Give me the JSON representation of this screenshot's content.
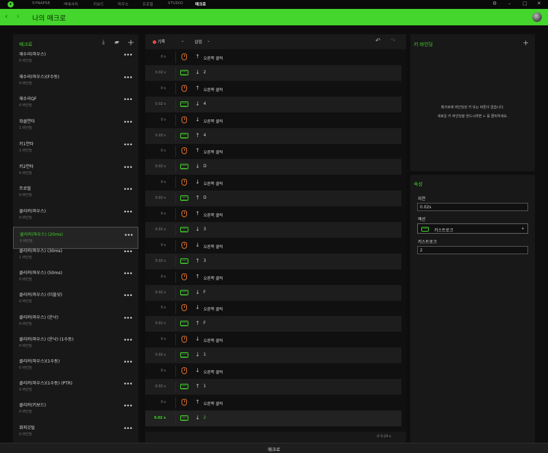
{
  "app": {
    "nav_tabs": [
      "SYNAPSE",
      "액세서리",
      "키보드",
      "마우스",
      "프로필",
      "STUDIO",
      "매크로"
    ],
    "active_tab": "매크로",
    "page_title": "나의 매크로",
    "accent_color": "#44d62c",
    "bottom_label": "매크로"
  },
  "macros": {
    "header": "매크로",
    "icons": [
      "import-icon",
      "folder-icon",
      "add-icon"
    ],
    "items": [
      {
        "name": "재수리(마우스)",
        "bind": "0 바인딩"
      },
      {
        "name": "재수리(마우스)(F수동)",
        "bind": "0 바인딩"
      },
      {
        "name": "재수리QF",
        "bind": "0 바인딩"
      },
      {
        "name": "좌클연타",
        "bind": "1 바인딩"
      },
      {
        "name": "키1연타",
        "bind": "1 바인딩"
      },
      {
        "name": "키2연타",
        "bind": "0 바인딩"
      },
      {
        "name": "프로필",
        "bind": "0 바인딩"
      },
      {
        "name": "클리커(마우스)",
        "bind": "0 바인딩"
      },
      {
        "name": "클리커(마우스) (20ms)",
        "bind": "0 바인딩",
        "selected": true
      },
      {
        "name": "클리커(마우스) (30ms)",
        "bind": "1 바인딩"
      },
      {
        "name": "클리커(마우스) (50ms)",
        "bind": "0 바인딩"
      },
      {
        "name": "클리커(마우스) (더블샷)",
        "bind": "0 바인딩"
      },
      {
        "name": "클리커(마우스) (운낙)",
        "bind": "0 바인딩"
      },
      {
        "name": "클리커(마우스) (운낙) (1수동)",
        "bind": "0 바인딩"
      },
      {
        "name": "클리커(마우스)(1수동)",
        "bind": "0 바인딩"
      },
      {
        "name": "클리커(마우스)(1수동) (PTR)",
        "bind": "0 바인딩"
      },
      {
        "name": "클리커(키보드)",
        "bind": "0 바인딩"
      },
      {
        "name": "회피깃털",
        "bind": "0 바인딩"
      }
    ]
  },
  "editor": {
    "record_label": "기록",
    "insert_label": "삽입",
    "total_duration": "0.24 s",
    "rows": [
      {
        "delay": "0 s",
        "type": "mouse",
        "dir": "up",
        "text": "오른쪽 클릭"
      },
      {
        "delay": "0.02 s",
        "type": "key",
        "dir": "down",
        "text": "2"
      },
      {
        "delay": "0 s",
        "type": "mouse",
        "dir": "up",
        "text": "오른쪽 클릭"
      },
      {
        "delay": "0.02 s",
        "type": "key",
        "dir": "down",
        "text": "4"
      },
      {
        "delay": "0 s",
        "type": "mouse",
        "dir": "down",
        "text": "오른쪽 클릭"
      },
      {
        "delay": "0.03 s",
        "type": "key",
        "dir": "up",
        "text": "4"
      },
      {
        "delay": "0 s",
        "type": "mouse",
        "dir": "up",
        "text": "오른쪽 클릭"
      },
      {
        "delay": "0.02 s",
        "type": "key",
        "dir": "down",
        "text": "D"
      },
      {
        "delay": "0 s",
        "type": "mouse",
        "dir": "down",
        "text": "오른쪽 클릭"
      },
      {
        "delay": "0.02 s",
        "type": "key",
        "dir": "up",
        "text": "D"
      },
      {
        "delay": "0 s",
        "type": "mouse",
        "dir": "up",
        "text": "오른쪽 클릭"
      },
      {
        "delay": "0.02 s",
        "type": "key",
        "dir": "down",
        "text": "3"
      },
      {
        "delay": "0 s",
        "type": "mouse",
        "dir": "down",
        "text": "오른쪽 클릭"
      },
      {
        "delay": "0.02 s",
        "type": "key",
        "dir": "up",
        "text": "3"
      },
      {
        "delay": "0 s",
        "type": "mouse",
        "dir": "up",
        "text": "오른쪽 클릭"
      },
      {
        "delay": "0.02 s",
        "type": "key",
        "dir": "down",
        "text": "F"
      },
      {
        "delay": "0 s",
        "type": "mouse",
        "dir": "down",
        "text": "오른쪽 클릭"
      },
      {
        "delay": "0.01 s",
        "type": "key",
        "dir": "up",
        "text": "F"
      },
      {
        "delay": "0 s",
        "type": "mouse",
        "dir": "down",
        "text": "오른쪽 클릭"
      },
      {
        "delay": "0.02 s",
        "type": "key",
        "dir": "down",
        "text": "1"
      },
      {
        "delay": "0 s",
        "type": "mouse",
        "dir": "down",
        "text": "오른쪽 클릭"
      },
      {
        "delay": "0.02 s",
        "type": "key",
        "dir": "up",
        "text": "1"
      },
      {
        "delay": "0 s",
        "type": "mouse",
        "dir": "up",
        "text": "오른쪽 클릭"
      },
      {
        "delay": "0.02 s",
        "type": "key",
        "dir": "down",
        "text": "2",
        "selected": true
      }
    ]
  },
  "keybinding": {
    "header": "키 바인딩",
    "empty_line1": "매크로에 바인딩된 키 또는 버튼이 없습니다.",
    "empty_line2": "새로운 키 바인딩을 만드시려면 + 를 클릭하세요."
  },
  "properties": {
    "header": "속성",
    "delay_label": "지연",
    "delay_value": "0.02s",
    "action_label": "액션",
    "action_value": "키스트로크",
    "keystroke_label": "키스트로크",
    "keystroke_value": "2"
  }
}
